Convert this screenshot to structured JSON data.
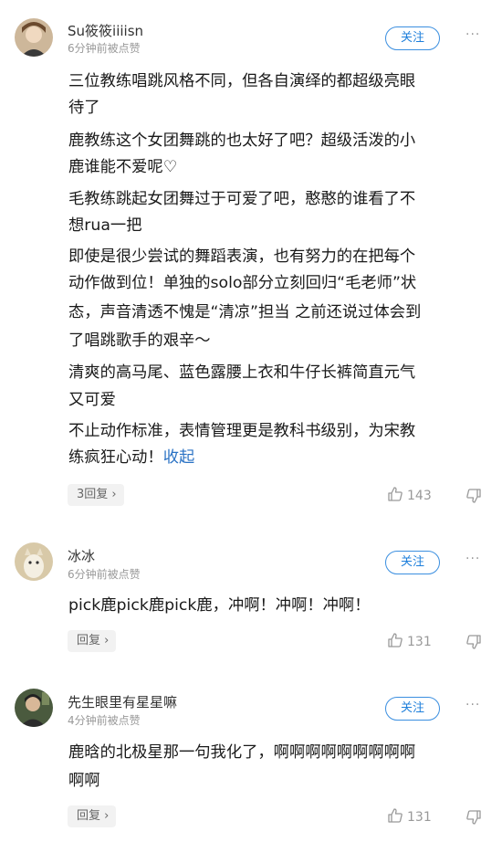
{
  "comments": [
    {
      "username": "Su筱筱iiiisn",
      "time": "6分钟前被点赞",
      "follow_label": "关注",
      "more": "···",
      "lines": [
        "三位教练唱跳风格不同，但各自演绎的都超级亮眼",
        "待了",
        "鹿教练这个女团舞跳的也太好了吧？超级活泼的小",
        "鹿谁能不爱呢♡",
        "毛教练跳起女团舞过于可爱了吧，憨憨的谁看了不",
        "想rua一把",
        "即使是很少尝试的舞蹈表演，也有努力的在把每个",
        "动作做到位！单独的solo部分立刻回归“毛老师”状",
        "态，声音清透不愧是“清凉”担当 之前还说过体会到",
        "了唱跳歌手的艰辛～",
        "清爽的高马尾、蓝色露腰上衣和牛仔长裤简直元气",
        "又可爱",
        "不止动作标准，表情管理更是教科书级别，为宋教"
      ],
      "last_line": "练疯狂心动！",
      "collapse_label": "收起",
      "reply_label": "3回复",
      "likes": "143",
      "reply_arrow": "›"
    },
    {
      "username": "冰冰",
      "time": "6分钟前被点赞",
      "follow_label": "关注",
      "more": "···",
      "lines": [
        "pick鹿pick鹿pick鹿，冲啊！冲啊！冲啊！"
      ],
      "reply_label": "回复",
      "likes": "131",
      "reply_arrow": "›"
    },
    {
      "username": "先生眼里有星星嘛",
      "time": "4分钟前被点赞",
      "follow_label": "关注",
      "more": "···",
      "lines": [
        "鹿晗的北极星那一句我化了，啊啊啊啊啊啊啊啊啊",
        "啊啊"
      ],
      "reply_label": "回复",
      "likes": "131",
      "reply_arrow": "›"
    }
  ],
  "colors": {
    "accent": "#1e7fdb",
    "link": "#2a72c4",
    "muted": "#999999"
  }
}
